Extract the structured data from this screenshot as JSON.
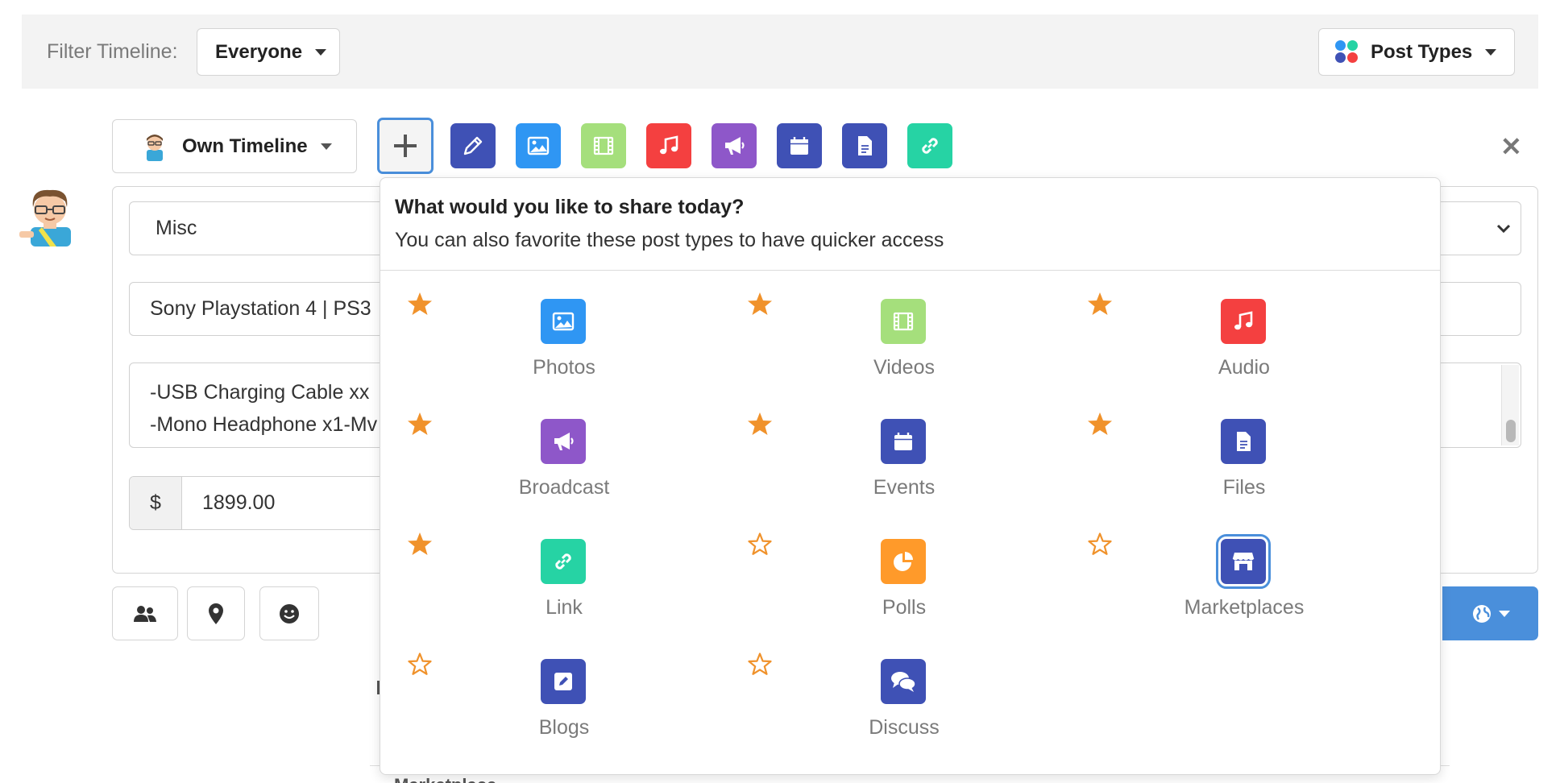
{
  "filter": {
    "label": "Filter Timeline:",
    "audience": "Everyone",
    "post_types_label": "Post Types"
  },
  "composer": {
    "timeline_label": "Own Timeline",
    "category": "Misc",
    "title_value": "Sony Playstation 4 | PS3",
    "description_lines": [
      "-USB Charging Cable xx",
      "-Mono Headphone x1-Mv"
    ],
    "currency_symbol": "$",
    "price_value": "1899.00"
  },
  "popup": {
    "title": "What would you like to share today?",
    "subtitle": "You can also favorite these post types to have quicker access",
    "post_types": [
      {
        "label": "Photos",
        "icon": "image-icon",
        "color": "#2f96f3",
        "favorited": true
      },
      {
        "label": "Videos",
        "icon": "film-icon",
        "color": "#a5df7c",
        "favorited": true
      },
      {
        "label": "Audio",
        "icon": "music-icon",
        "color": "#f44040",
        "favorited": true
      },
      {
        "label": "Broadcast",
        "icon": "megaphone-icon",
        "color": "#8e57c9",
        "favorited": true
      },
      {
        "label": "Events",
        "icon": "calendar-icon",
        "color": "#3f51b5",
        "favorited": true
      },
      {
        "label": "Files",
        "icon": "file-icon",
        "color": "#3f51b5",
        "favorited": true
      },
      {
        "label": "Link",
        "icon": "link-icon",
        "color": "#26d3a4",
        "favorited": true
      },
      {
        "label": "Polls",
        "icon": "pie-chart-icon",
        "color": "#ff9a2a",
        "favorited": false
      },
      {
        "label": "Marketplaces",
        "icon": "store-icon",
        "color": "#3f51b5",
        "favorited": false,
        "selected": true
      },
      {
        "label": "Blogs",
        "icon": "edit-icon",
        "color": "#3f51b5",
        "favorited": false
      },
      {
        "label": "Discuss",
        "icon": "chat-icon",
        "color": "#3f51b5",
        "favorited": false
      }
    ]
  },
  "background": {
    "hidden_heading": "Marketplace"
  },
  "colors": {
    "accent": "#4a8fdb",
    "star": "#f0922b",
    "filter_bg": "#f3f3f3"
  }
}
